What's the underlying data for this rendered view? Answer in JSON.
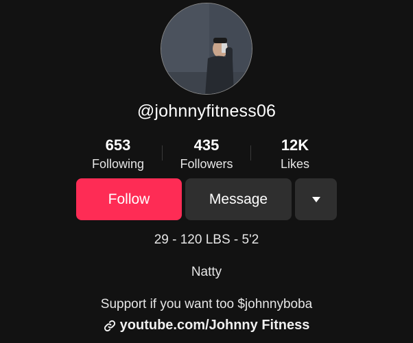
{
  "profile": {
    "username": "@johnnyfitness06"
  },
  "stats": [
    {
      "value": "653",
      "label": "Following"
    },
    {
      "value": "435",
      "label": "Followers"
    },
    {
      "value": "12K",
      "label": "Likes"
    }
  ],
  "actions": {
    "follow_label": "Follow",
    "message_label": "Message",
    "more_icon": "caret-down-icon"
  },
  "bio": {
    "line1": "29 - 120 LBS - 5'2",
    "line2": "Natty",
    "line3": "Support if you want too $johnnyboba"
  },
  "link": {
    "icon": "link-icon",
    "text": "youtube.com/Johnny Fitness"
  },
  "colors": {
    "background": "#121212",
    "follow_button": "#fe2c55",
    "secondary_button": "#2f2f2f"
  }
}
